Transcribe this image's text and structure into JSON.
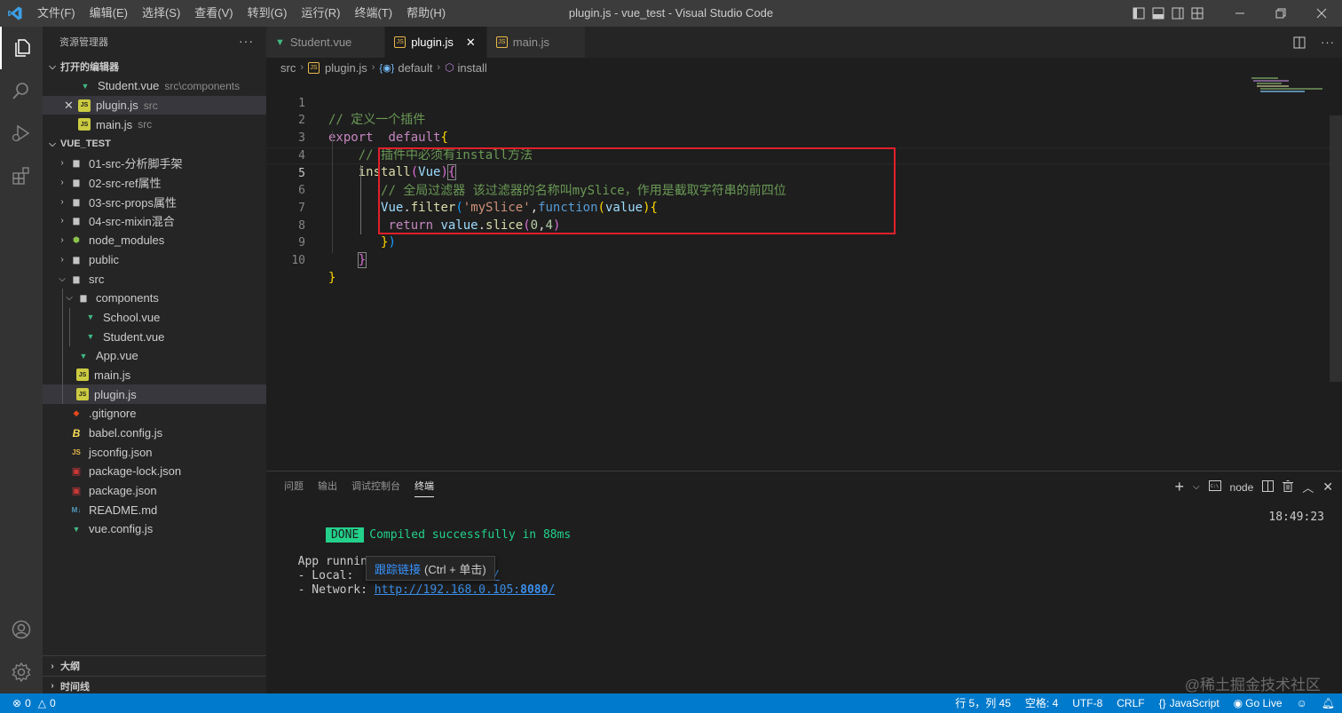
{
  "window": {
    "title": "plugin.js - vue_test - Visual Studio Code"
  },
  "menu": [
    "文件(F)",
    "编辑(E)",
    "选择(S)",
    "查看(V)",
    "转到(G)",
    "运行(R)",
    "终端(T)",
    "帮助(H)"
  ],
  "sidebar": {
    "title": "资源管理器",
    "open_editors": {
      "label": "打开的编辑器",
      "items": [
        {
          "name": "Student.vue",
          "desc": "src\\components",
          "icon": "vue-icon"
        },
        {
          "name": "plugin.js",
          "desc": "src",
          "icon": "js-icon",
          "active": true
        },
        {
          "name": "main.js",
          "desc": "src",
          "icon": "js-icon"
        }
      ]
    },
    "project": {
      "label": "VUE_TEST",
      "items": [
        {
          "name": "01-src-分析脚手架",
          "type": "folder",
          "expanded": false
        },
        {
          "name": "02-src-ref属性",
          "type": "folder",
          "expanded": false
        },
        {
          "name": "03-src-props属性",
          "type": "folder",
          "expanded": false
        },
        {
          "name": "04-src-mixin混合",
          "type": "folder",
          "expanded": false
        },
        {
          "name": "node_modules",
          "type": "folder",
          "expanded": false
        },
        {
          "name": "public",
          "type": "folder",
          "expanded": false
        },
        {
          "name": "src",
          "type": "folder",
          "expanded": true
        },
        {
          "name": "components",
          "type": "folder",
          "expanded": true
        },
        {
          "name": "School.vue",
          "type": "vue"
        },
        {
          "name": "Student.vue",
          "type": "vue"
        },
        {
          "name": "App.vue",
          "type": "vue"
        },
        {
          "name": "main.js",
          "type": "js"
        },
        {
          "name": "plugin.js",
          "type": "js",
          "selected": true
        },
        {
          "name": ".gitignore",
          "type": "git"
        },
        {
          "name": "babel.config.js",
          "type": "babel"
        },
        {
          "name": "jsconfig.json",
          "type": "jsconfig"
        },
        {
          "name": "package-lock.json",
          "type": "npm"
        },
        {
          "name": "package.json",
          "type": "npm"
        },
        {
          "name": "README.md",
          "type": "md"
        },
        {
          "name": "vue.config.js",
          "type": "vue"
        }
      ]
    },
    "outline_label": "大纲",
    "timeline_label": "时间线"
  },
  "tabs": [
    {
      "label": "Student.vue",
      "icon": "vue-icon"
    },
    {
      "label": "plugin.js",
      "icon": "js-icon",
      "active": true,
      "close": "✕"
    },
    {
      "label": "main.js",
      "icon": "js-icon"
    }
  ],
  "breadcrumb": {
    "a": "src",
    "b": "plugin.js",
    "c": "default",
    "d": "install"
  },
  "code": {
    "line_numbers": [
      "1",
      "2",
      "3",
      "4",
      "5",
      "6",
      "7",
      "8",
      "9",
      "10"
    ],
    "current_line": 5,
    "l1_comment": "// 定义一个插件",
    "l2_export": "export",
    "l2_default": "default",
    "l2_brace": "{",
    "l3_comment": "// 插件中必须有install方法",
    "l4_install": "install",
    "l4_p1": "(",
    "l4_vue": "Vue",
    "l4_p2": ")",
    "l4_brace": "{",
    "l5_comment": "// 全局过滤器 该过滤器的名称叫mySlice，作用是截取字符串的前四位",
    "l6_vue": "Vue",
    "l6_dot": ".",
    "l6_filter": "filter",
    "l6_p1": "(",
    "l6_str": "'mySlice'",
    "l6_comma": ",",
    "l6_function": "function",
    "l6_p2": "(",
    "l6_value": "value",
    "l6_p3": ")",
    "l6_brace": "{",
    "l7_return": "return",
    "l7_value": "value",
    "l7_dot": ".",
    "l7_slice": "slice",
    "l7_p1": "(",
    "l7_n0": "0",
    "l7_comma": ",",
    "l7_n4": "4",
    "l7_p2": ")",
    "l8_brace": "}",
    "l8_paren": ")",
    "l9_brace": "}",
    "l10_brace": "}"
  },
  "panel": {
    "tabs": [
      "问题",
      "输出",
      "调试控制台",
      "终端"
    ],
    "active_tab": "终端",
    "terminal_name": "node",
    "done": "DONE",
    "compiled": "Compiled successfully in 88ms",
    "time": "18:49:23",
    "app_running": "App running",
    "local_label": "- Local:",
    "local_url_tail": "0/",
    "network_label": "- Network:",
    "network_url_a": "http://192.168.0.105:",
    "network_url_port": "8080",
    "network_url_b": "/"
  },
  "tooltip": {
    "link": "跟踪链接",
    "hint": "(Ctrl + 单击)"
  },
  "watermark": "@稀土掘金技术社区",
  "statusbar": {
    "errors": "0",
    "warnings": "0",
    "position": "行 5，列 45",
    "spaces": "空格: 4",
    "encoding": "UTF-8",
    "eol": "CRLF",
    "language": "JavaScript",
    "golive": "Go Live"
  },
  "colors": {
    "accent": "#007acc",
    "highlight_box": "#e0202a",
    "done": "#23d18b"
  }
}
